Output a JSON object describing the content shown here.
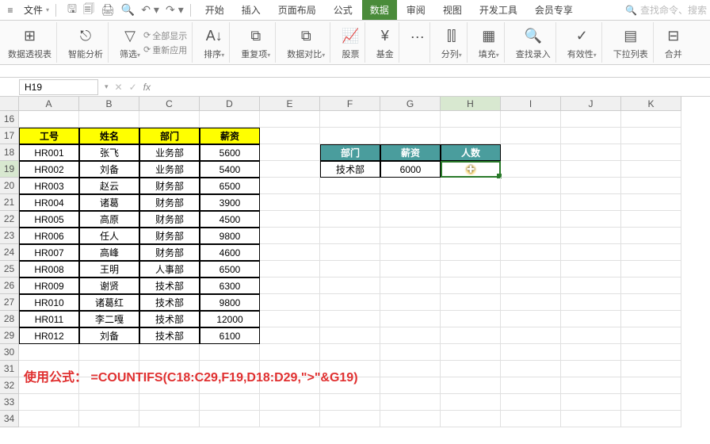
{
  "menu": {
    "file": "文件",
    "tabs": [
      "开始",
      "插入",
      "页面布局",
      "公式",
      "数据",
      "审阅",
      "视图",
      "开发工具",
      "会员专享"
    ],
    "active_tab": 4,
    "search_placeholder": "查找命令、搜索"
  },
  "ribbon": {
    "pivot": "数据透视表",
    "smart": "智能分析",
    "filter": "筛选",
    "show_all": "全部显示",
    "reapply": "重新应用",
    "sort": "排序",
    "dupes": "重复项",
    "compare": "数据对比",
    "stock": "股票",
    "fund": "基金",
    "split": "分列",
    "fill": "填充",
    "importrec": "查找录入",
    "validity": "有效性",
    "droplist": "下拉列表",
    "merge": "合并"
  },
  "namebox": {
    "cell": "H19",
    "fx": "fx"
  },
  "columns": [
    "A",
    "B",
    "C",
    "D",
    "E",
    "F",
    "G",
    "H",
    "I",
    "J",
    "K"
  ],
  "active_col": "H",
  "active_row": "19",
  "headers": {
    "id": "工号",
    "name": "姓名",
    "dept": "部门",
    "salary": "薪资"
  },
  "side_headers": {
    "dept": "部门",
    "salary": "薪资",
    "count": "人数"
  },
  "side_data": {
    "dept": "技术部",
    "salary": "6000"
  },
  "rows": [
    {
      "n": "18",
      "id": "HR001",
      "name": "张飞",
      "dept": "业务部",
      "salary": "5600"
    },
    {
      "n": "19",
      "id": "HR002",
      "name": "刘备",
      "dept": "业务部",
      "salary": "5400"
    },
    {
      "n": "20",
      "id": "HR003",
      "name": "赵云",
      "dept": "财务部",
      "salary": "6500"
    },
    {
      "n": "21",
      "id": "HR004",
      "name": "诸葛",
      "dept": "财务部",
      "salary": "3900"
    },
    {
      "n": "22",
      "id": "HR005",
      "name": "高原",
      "dept": "财务部",
      "salary": "4500"
    },
    {
      "n": "23",
      "id": "HR006",
      "name": "任人",
      "dept": "财务部",
      "salary": "9800"
    },
    {
      "n": "24",
      "id": "HR007",
      "name": "高峰",
      "dept": "财务部",
      "salary": "4600"
    },
    {
      "n": "25",
      "id": "HR008",
      "name": "王明",
      "dept": "人事部",
      "salary": "6500"
    },
    {
      "n": "26",
      "id": "HR009",
      "name": "谢贤",
      "dept": "技术部",
      "salary": "6300"
    },
    {
      "n": "27",
      "id": "HR010",
      "name": "诸葛红",
      "dept": "技术部",
      "salary": "9800"
    },
    {
      "n": "28",
      "id": "HR011",
      "name": "李二嘎",
      "dept": "技术部",
      "salary": "12000"
    },
    {
      "n": "29",
      "id": "HR012",
      "name": "刘备",
      "dept": "技术部",
      "salary": "6100"
    }
  ],
  "formula_label": "使用公式：",
  "formula_text": "=COUNTIFS(C18:C29,F19,D18:D29,\">\"&G19)"
}
